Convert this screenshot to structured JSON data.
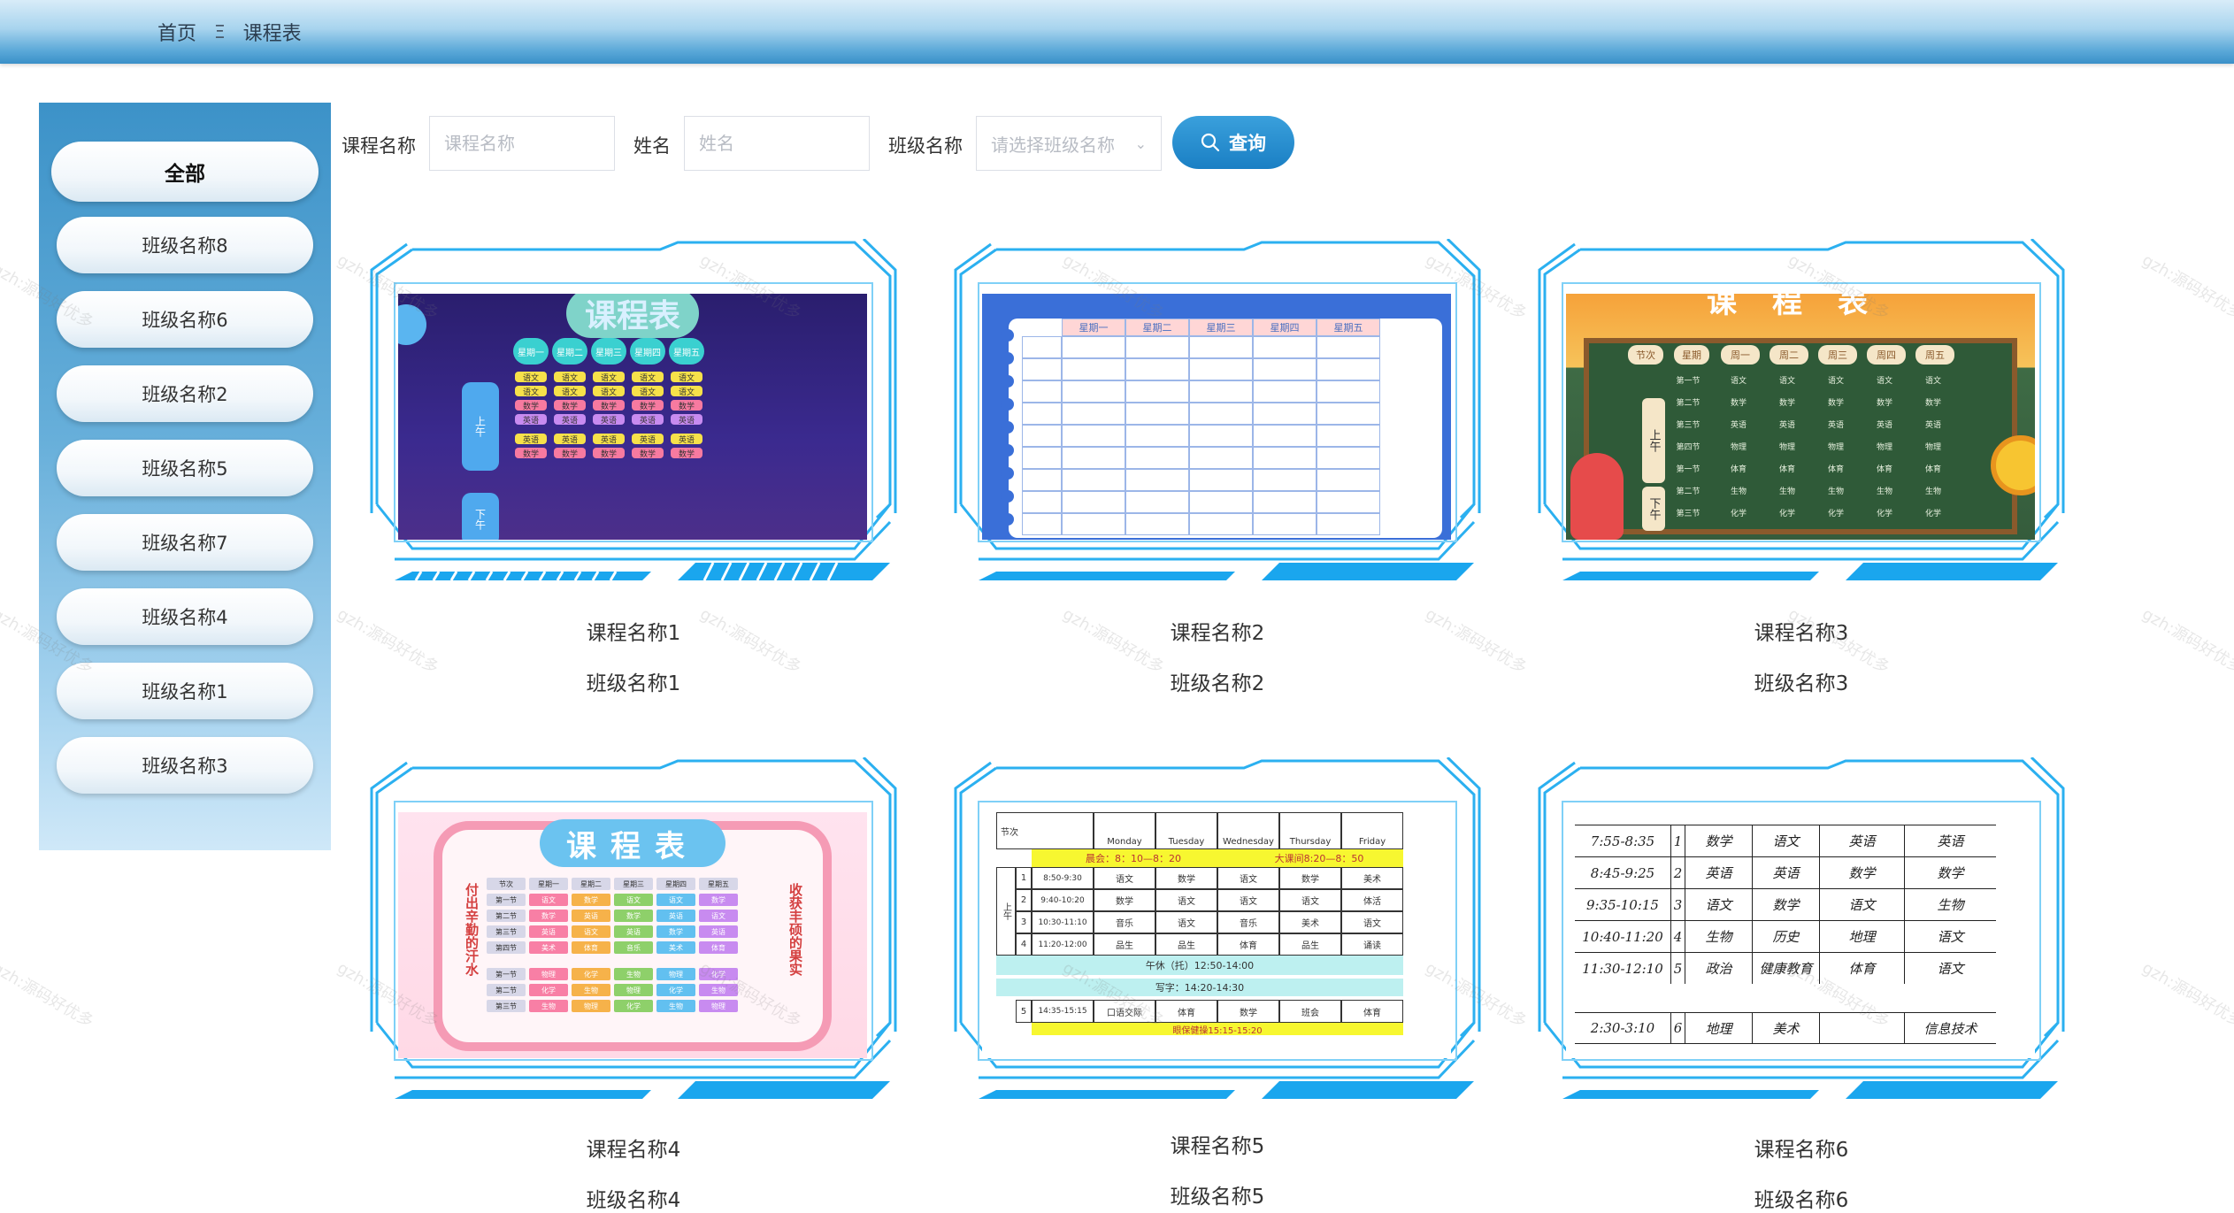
{
  "breadcrumb": {
    "home": "首页",
    "separator": "Ξ",
    "current": "课程表"
  },
  "sidebar": {
    "items": [
      {
        "label": "全部",
        "active": true
      },
      {
        "label": "班级名称8"
      },
      {
        "label": "班级名称6"
      },
      {
        "label": "班级名称2"
      },
      {
        "label": "班级名称5"
      },
      {
        "label": "班级名称7"
      },
      {
        "label": "班级名称4"
      },
      {
        "label": "班级名称1"
      },
      {
        "label": "班级名称3"
      }
    ]
  },
  "search": {
    "course_label": "课程名称",
    "course_placeholder": "课程名称",
    "name_label": "姓名",
    "name_placeholder": "姓名",
    "class_label": "班级名称",
    "class_placeholder": "请选择班级名称",
    "query_button": "查询"
  },
  "cards": [
    {
      "title": "课程名称1",
      "class": "班级名称1"
    },
    {
      "title": "课程名称2",
      "class": "班级名称2"
    },
    {
      "title": "课程名称3",
      "class": "班级名称3"
    },
    {
      "title": "课程名称4",
      "class": "班级名称4"
    },
    {
      "title": "课程名称5",
      "class": "班级名称5"
    },
    {
      "title": "课程名称6",
      "class": "班级名称6"
    }
  ],
  "thumbnails": {
    "t1": {
      "title": "课程表",
      "days": [
        "星期一",
        "星期二",
        "星期三",
        "星期四",
        "星期五"
      ],
      "am": "上午",
      "pm": "下午",
      "rows": [
        [
          "语文",
          "语文",
          "语文",
          "语文",
          "语文"
        ],
        [
          "语文",
          "语文",
          "语文",
          "语文",
          "语文"
        ],
        [
          "数学",
          "数学",
          "数学",
          "数学",
          "数学"
        ],
        [
          "英语",
          "英语",
          "英语",
          "英语",
          "英语"
        ],
        [
          "英语",
          "英语",
          "英语",
          "英语",
          "英语"
        ],
        [
          "数学",
          "数学",
          "数学",
          "数学",
          "数学"
        ]
      ]
    },
    "t2": {
      "days": [
        "星期一",
        "星期二",
        "星期三",
        "星期四",
        "星期五"
      ]
    },
    "t3": {
      "title": "课程表",
      "header": [
        "节次",
        "星期",
        "周一",
        "周二",
        "周三",
        "周四",
        "周五"
      ],
      "am": "上午",
      "pm": "下午",
      "rows": [
        [
          "第一节",
          "语文",
          "语文",
          "语文",
          "语文",
          "语文"
        ],
        [
          "第二节",
          "数学",
          "数学",
          "数学",
          "数学",
          "数学"
        ],
        [
          "第三节",
          "英语",
          "英语",
          "英语",
          "英语",
          "英语"
        ],
        [
          "第四节",
          "物理",
          "物理",
          "物理",
          "物理",
          "物理"
        ],
        [
          "第一节",
          "体育",
          "体育",
          "体育",
          "体育",
          "体育"
        ],
        [
          "第二节",
          "生物",
          "生物",
          "生物",
          "生物",
          "生物"
        ],
        [
          "第三节",
          "化学",
          "化学",
          "化学",
          "化学",
          "化学"
        ]
      ]
    },
    "t4": {
      "title": "课程表",
      "left_text": "付出辛勤的汗水",
      "right_text": "收获丰硕的果实",
      "header": [
        "节次",
        "星期一",
        "星期二",
        "星期三",
        "星期四",
        "星期五"
      ],
      "am": "上午",
      "pm": "下午",
      "rows": [
        [
          "第一节",
          "语文",
          "数学",
          "语文",
          "语文",
          "数学"
        ],
        [
          "第二节",
          "数学",
          "英语",
          "数学",
          "英语",
          "语文"
        ],
        [
          "第三节",
          "英语",
          "语文",
          "英语",
          "数学",
          "英语"
        ],
        [
          "第四节",
          "美术",
          "体育",
          "音乐",
          "美术",
          "体育"
        ],
        [
          "第一节",
          "物理",
          "化学",
          "生物",
          "物理",
          "化学"
        ],
        [
          "第二节",
          "化学",
          "生物",
          "物理",
          "化学",
          "生物"
        ],
        [
          "第三节",
          "生物",
          "物理",
          "化学",
          "生物",
          "物理"
        ]
      ]
    },
    "t5": {
      "header": [
        "节次",
        "Monday",
        "Tuesday",
        "Wednesday",
        "Thursday",
        "Friday"
      ],
      "morning_bar": "晨会：8：10—8：20",
      "break_bar": "大课间8:20—8：50",
      "am": "上午",
      "rows": [
        [
          "1",
          "8:50-9:30",
          "语文",
          "数学",
          "语文",
          "数学",
          "美术"
        ],
        [
          "2",
          "9:40-10:20",
          "数学",
          "语文",
          "语文",
          "语文",
          "体活"
        ],
        [
          "3",
          "10:30-11:10",
          "音乐",
          "语文",
          "音乐",
          "美术",
          "语文"
        ],
        [
          "4",
          "11:20-12:00",
          "品生",
          "品生",
          "体育",
          "品生",
          "诵读"
        ]
      ],
      "lunch": "午休（托）12:50-14:00",
      "writing": "写字：14:20-14:30",
      "row5": [
        "5",
        "14:35-15:15",
        "口语交际",
        "体育",
        "数学",
        "班会",
        "体育"
      ],
      "bottom": "眼保健操15:15-15:20"
    },
    "t6": {
      "rows": [
        [
          "7:55-8:35",
          "1",
          "数学",
          "语文",
          "英语",
          "英语"
        ],
        [
          "8:45-9:25",
          "2",
          "英语",
          "英语",
          "数学",
          "数学"
        ],
        [
          "9:35-10:15",
          "3",
          "语文",
          "数学",
          "语文",
          "生物"
        ],
        [
          "10:40-11:20",
          "4",
          "生物",
          "历史",
          "地理",
          "语文"
        ],
        [
          "11:30-12:10",
          "5",
          "政治",
          "健康教育",
          "体育",
          "语文"
        ]
      ],
      "afternoon": [
        "2:30-3:10",
        "6",
        "地理",
        "美术",
        "",
        "信息技术"
      ]
    }
  },
  "watermark": "gzh:源码好优多",
  "colors": {
    "accent": "#1a7fc4",
    "topbar": "#3a90c8",
    "sidebar": "#67afda",
    "frame": "#2bb0f0"
  }
}
